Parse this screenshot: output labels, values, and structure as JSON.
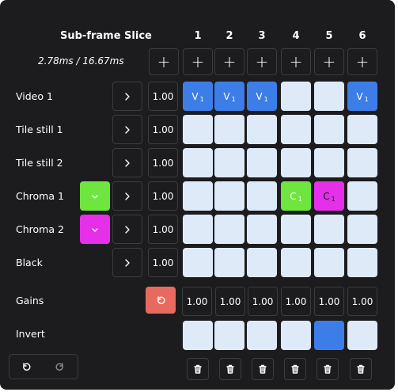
{
  "header": {
    "title": "Sub-frame Slice",
    "ratio": "2.78ms / 16.67ms"
  },
  "columns": [
    "1",
    "2",
    "3",
    "4",
    "5",
    "6"
  ],
  "rows": [
    {
      "label": "Video 1",
      "gain": "1.00",
      "swatch": null,
      "cells": [
        {
          "text": "V",
          "sub": "1",
          "color": "#3d7de8"
        },
        {
          "text": "V",
          "sub": "1",
          "color": "#3d7de8"
        },
        {
          "text": "V",
          "sub": "1",
          "color": "#3d7de8"
        },
        {
          "text": "",
          "sub": "",
          "color": "#dfeaf8"
        },
        {
          "text": "",
          "sub": "",
          "color": "#dfeaf8"
        },
        {
          "text": "V",
          "sub": "1",
          "color": "#3d7de8"
        }
      ]
    },
    {
      "label": "Tile still 1",
      "gain": "1.00",
      "swatch": null,
      "cells": [
        {
          "text": "",
          "sub": "",
          "color": "#dfeaf8"
        },
        {
          "text": "",
          "sub": "",
          "color": "#dfeaf8"
        },
        {
          "text": "",
          "sub": "",
          "color": "#dfeaf8"
        },
        {
          "text": "",
          "sub": "",
          "color": "#dfeaf8"
        },
        {
          "text": "",
          "sub": "",
          "color": "#dfeaf8"
        },
        {
          "text": "",
          "sub": "",
          "color": "#dfeaf8"
        }
      ]
    },
    {
      "label": "Tile still 2",
      "gain": "1.00",
      "swatch": null,
      "cells": [
        {
          "text": "",
          "sub": "",
          "color": "#dfeaf8"
        },
        {
          "text": "",
          "sub": "",
          "color": "#dfeaf8"
        },
        {
          "text": "",
          "sub": "",
          "color": "#dfeaf8"
        },
        {
          "text": "",
          "sub": "",
          "color": "#dfeaf8"
        },
        {
          "text": "",
          "sub": "",
          "color": "#dfeaf8"
        },
        {
          "text": "",
          "sub": "",
          "color": "#dfeaf8"
        }
      ]
    },
    {
      "label": "Chroma 1",
      "gain": "1.00",
      "swatch": "#6ee63f",
      "cells": [
        {
          "text": "",
          "sub": "",
          "color": "#dfeaf8"
        },
        {
          "text": "",
          "sub": "",
          "color": "#dfeaf8"
        },
        {
          "text": "",
          "sub": "",
          "color": "#dfeaf8"
        },
        {
          "text": "C",
          "sub": "1",
          "color": "#6ee63f"
        },
        {
          "text": "C",
          "sub": "1",
          "color": "#e52fe8",
          "dark": true
        },
        {
          "text": "",
          "sub": "",
          "color": "#dfeaf8"
        }
      ]
    },
    {
      "label": "Chroma 2",
      "gain": "1.00",
      "swatch": "#e52fe8",
      "cells": [
        {
          "text": "",
          "sub": "",
          "color": "#dfeaf8"
        },
        {
          "text": "",
          "sub": "",
          "color": "#dfeaf8"
        },
        {
          "text": "",
          "sub": "",
          "color": "#dfeaf8"
        },
        {
          "text": "",
          "sub": "",
          "color": "#dfeaf8"
        },
        {
          "text": "",
          "sub": "",
          "color": "#dfeaf8"
        },
        {
          "text": "",
          "sub": "",
          "color": "#dfeaf8"
        }
      ]
    },
    {
      "label": "Black",
      "gain": "1.00",
      "swatch": null,
      "cells": [
        {
          "text": "",
          "sub": "",
          "color": "#dfeaf8"
        },
        {
          "text": "",
          "sub": "",
          "color": "#dfeaf8"
        },
        {
          "text": "",
          "sub": "",
          "color": "#dfeaf8"
        },
        {
          "text": "",
          "sub": "",
          "color": "#dfeaf8"
        },
        {
          "text": "",
          "sub": "",
          "color": "#dfeaf8"
        },
        {
          "text": "",
          "sub": "",
          "color": "#dfeaf8"
        }
      ]
    }
  ],
  "gains": {
    "label": "Gains",
    "values": [
      "1.00",
      "1.00",
      "1.00",
      "1.00",
      "1.00",
      "1.00"
    ],
    "reset_color": "#e86a5e"
  },
  "invert": {
    "label": "Invert",
    "active": [
      false,
      false,
      false,
      false,
      true,
      false
    ],
    "on_color": "#3d7de8",
    "off_color": "#dfeaf8"
  },
  "icons": {
    "plus": "plus-icon",
    "chevron": "chevron-right-icon",
    "undo": "undo-icon",
    "redo": "redo-icon",
    "trash": "trash-icon",
    "reset": "reset-icon"
  },
  "colors": {
    "background": "#1c1c1e",
    "border": "#3c3c3f",
    "cell": "#dfeaf8",
    "text": "#ffffff"
  }
}
